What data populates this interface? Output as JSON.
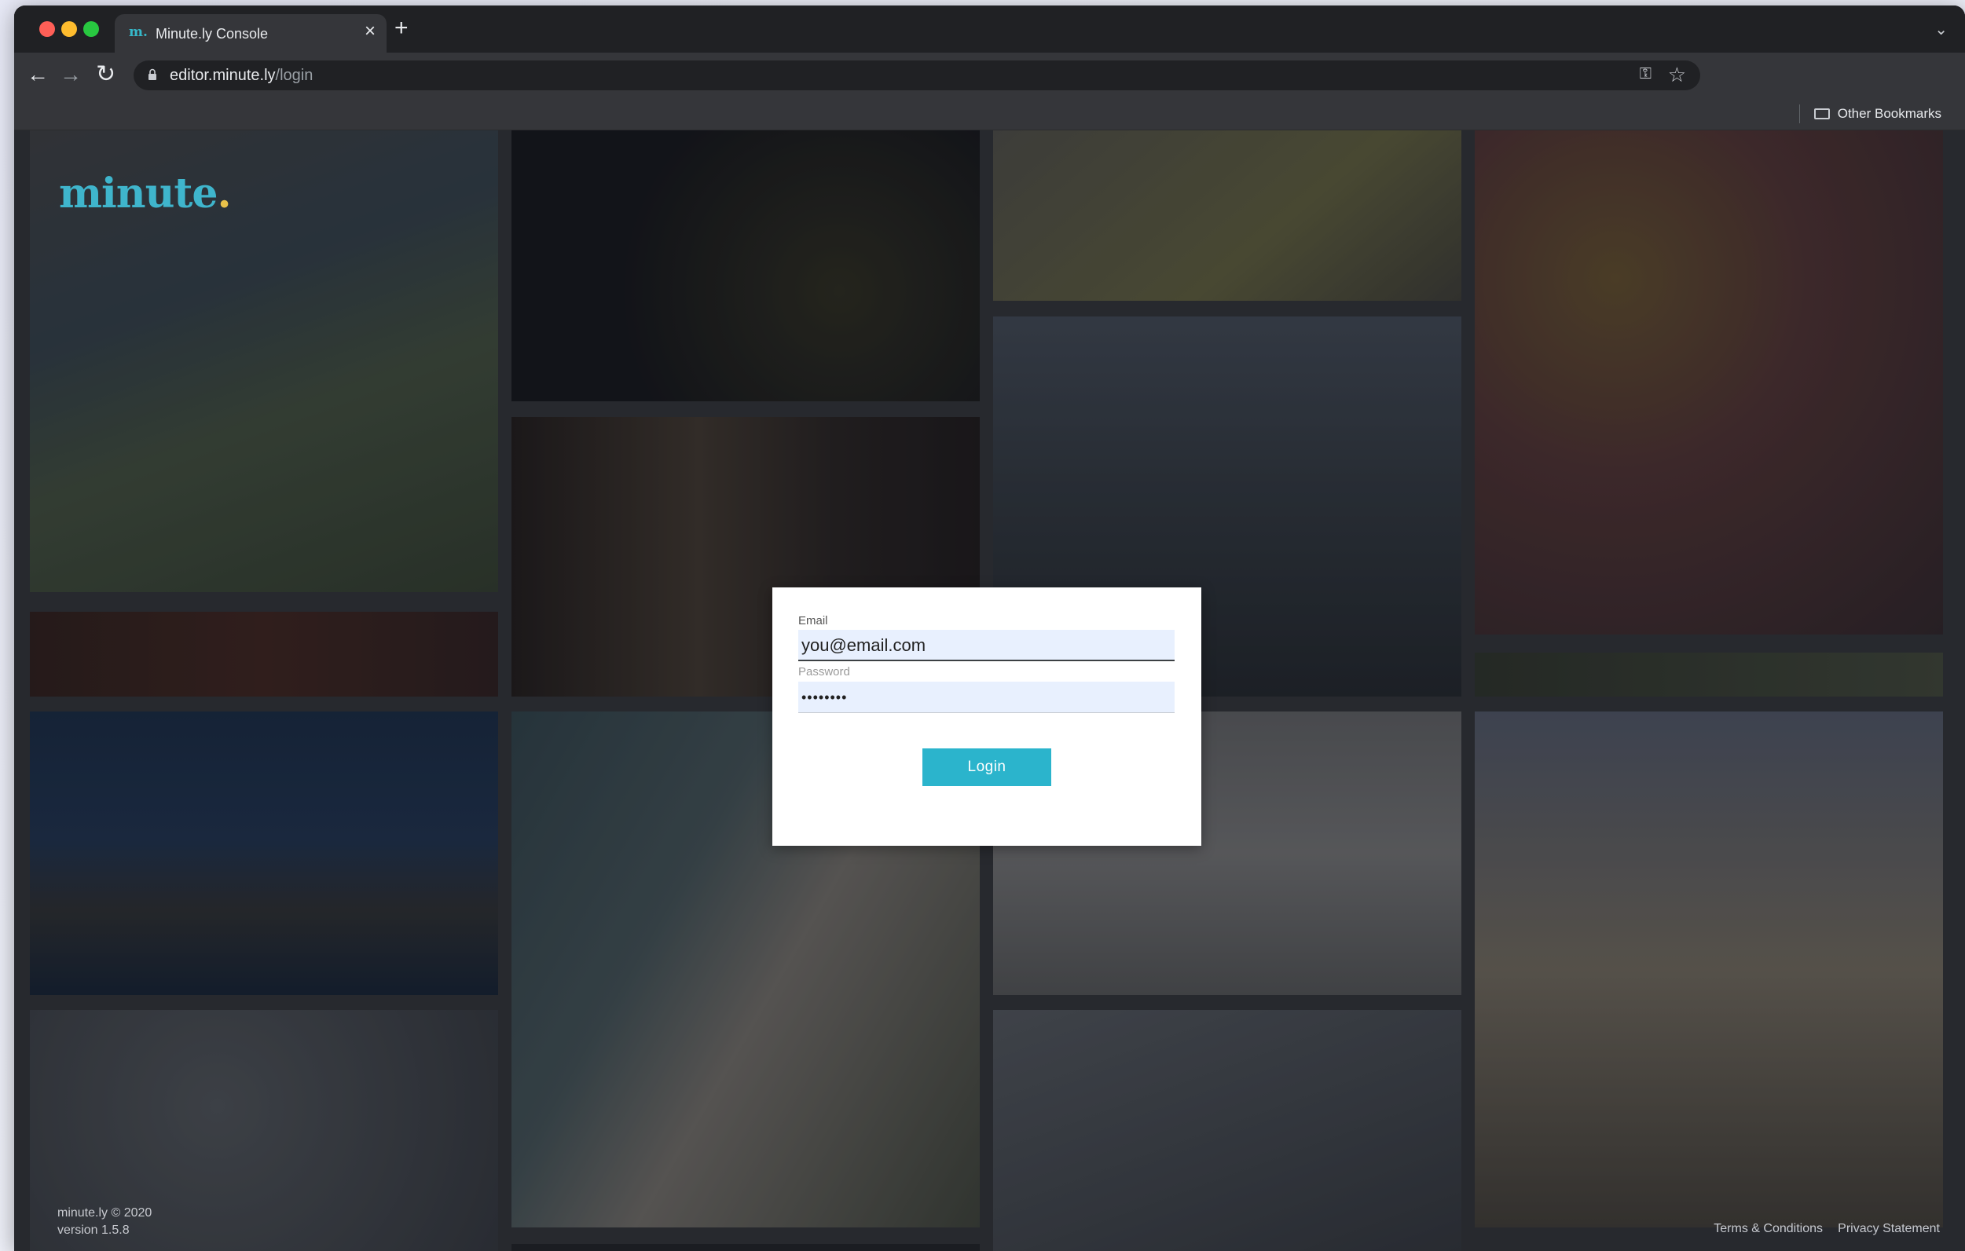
{
  "browser": {
    "tab_title": "Minute.ly Console",
    "tab_favicon": "m.",
    "tab_close": "×",
    "new_tab": "+",
    "url_host": "editor.minute.ly",
    "url_path": "/login",
    "bookmark_other": "Other Bookmarks",
    "icons": [
      "back-icon",
      "forward-icon",
      "reload-icon",
      "lock-icon",
      "key-icon",
      "star-icon",
      "folder-icon",
      "chevron-down-icon"
    ]
  },
  "page": {
    "logo_text": "minute",
    "logo_dot": ".",
    "footer": {
      "copyright": "minute.ly © 2020",
      "version": "version 1.5.8",
      "terms": "Terms & Conditions",
      "privacy": "Privacy Statement"
    },
    "colors": {
      "brand": "#3fb5cc",
      "button": "#2bb4cc",
      "logo_dot": "#e8c14a"
    }
  },
  "login": {
    "email_label": "Email",
    "email_value": "you@email.com",
    "password_label": "Password",
    "password_value": "••••••••",
    "login_button": "Login"
  }
}
